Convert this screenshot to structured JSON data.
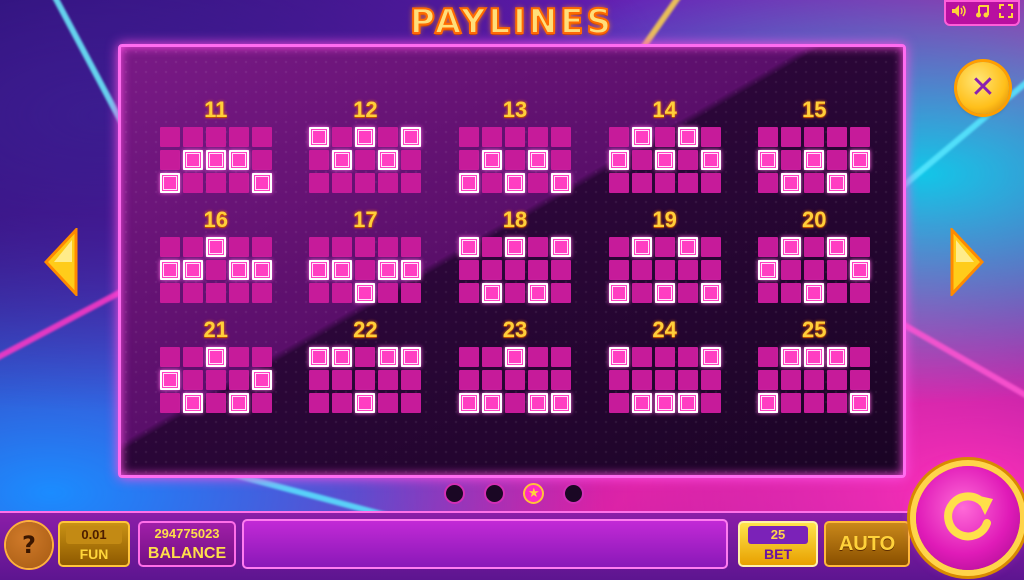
{
  "header": {
    "title": "PAYLINES"
  },
  "top_controls": {
    "sound_icon": "speaker-icon",
    "music_icon": "music-note-icon",
    "fullscreen_icon": "fullscreen-icon"
  },
  "paylines": [
    {
      "number": "11",
      "rows": [
        [
          0,
          0,
          0,
          0,
          0
        ],
        [
          0,
          1,
          1,
          1,
          0
        ],
        [
          1,
          0,
          0,
          0,
          1
        ]
      ]
    },
    {
      "number": "12",
      "rows": [
        [
          1,
          0,
          1,
          0,
          1
        ],
        [
          0,
          1,
          0,
          1,
          0
        ],
        [
          0,
          0,
          0,
          0,
          0
        ]
      ]
    },
    {
      "number": "13",
      "rows": [
        [
          0,
          0,
          0,
          0,
          0
        ],
        [
          0,
          1,
          0,
          1,
          0
        ],
        [
          1,
          0,
          1,
          0,
          1
        ]
      ]
    },
    {
      "number": "14",
      "rows": [
        [
          0,
          1,
          0,
          1,
          0
        ],
        [
          1,
          0,
          1,
          0,
          1
        ],
        [
          0,
          0,
          0,
          0,
          0
        ]
      ]
    },
    {
      "number": "15",
      "rows": [
        [
          0,
          0,
          0,
          0,
          0
        ],
        [
          1,
          0,
          1,
          0,
          1
        ],
        [
          0,
          1,
          0,
          1,
          0
        ]
      ]
    },
    {
      "number": "16",
      "rows": [
        [
          0,
          0,
          1,
          0,
          0
        ],
        [
          1,
          1,
          0,
          1,
          1
        ],
        [
          0,
          0,
          0,
          0,
          0
        ]
      ]
    },
    {
      "number": "17",
      "rows": [
        [
          0,
          0,
          0,
          0,
          0
        ],
        [
          1,
          1,
          0,
          1,
          1
        ],
        [
          0,
          0,
          1,
          0,
          0
        ]
      ]
    },
    {
      "number": "18",
      "rows": [
        [
          1,
          0,
          1,
          0,
          1
        ],
        [
          0,
          0,
          0,
          0,
          0
        ],
        [
          0,
          1,
          0,
          1,
          0
        ]
      ]
    },
    {
      "number": "19",
      "rows": [
        [
          0,
          1,
          0,
          1,
          0
        ],
        [
          0,
          0,
          0,
          0,
          0
        ],
        [
          1,
          0,
          1,
          0,
          1
        ]
      ]
    },
    {
      "number": "20",
      "rows": [
        [
          0,
          1,
          0,
          1,
          0
        ],
        [
          1,
          0,
          0,
          0,
          1
        ],
        [
          0,
          0,
          1,
          0,
          0
        ]
      ]
    },
    {
      "number": "21",
      "rows": [
        [
          0,
          0,
          1,
          0,
          0
        ],
        [
          1,
          0,
          0,
          0,
          1
        ],
        [
          0,
          1,
          0,
          1,
          0
        ]
      ]
    },
    {
      "number": "22",
      "rows": [
        [
          1,
          1,
          0,
          1,
          1
        ],
        [
          0,
          0,
          0,
          0,
          0
        ],
        [
          0,
          0,
          1,
          0,
          0
        ]
      ]
    },
    {
      "number": "23",
      "rows": [
        [
          0,
          0,
          1,
          0,
          0
        ],
        [
          0,
          0,
          0,
          0,
          0
        ],
        [
          1,
          1,
          0,
          1,
          1
        ]
      ]
    },
    {
      "number": "24",
      "rows": [
        [
          1,
          0,
          0,
          0,
          1
        ],
        [
          0,
          0,
          0,
          0,
          0
        ],
        [
          0,
          1,
          1,
          1,
          0
        ]
      ]
    },
    {
      "number": "25",
      "rows": [
        [
          0,
          1,
          1,
          1,
          0
        ],
        [
          0,
          0,
          0,
          0,
          0
        ],
        [
          1,
          0,
          0,
          0,
          1
        ]
      ]
    }
  ],
  "navigation": {
    "prev_icon": "arrow-left-icon",
    "next_icon": "arrow-right-icon",
    "close_label": "✕"
  },
  "pager": {
    "pages": 4,
    "active_index": 2,
    "active_symbol": "★"
  },
  "bottom_bar": {
    "help_label": "?",
    "fun_value": "0.01",
    "fun_label": "FUN",
    "balance_value": "294775023",
    "balance_label": "BALANCE",
    "message": "",
    "bet_value": "25",
    "bet_label": "BET",
    "auto_label": "AUTO",
    "spin_icon": "spin-arrow-icon"
  },
  "colors": {
    "accent_gold": "#ffcf3a",
    "cell_off": "#c61b9a",
    "cell_on": "#ff3fc2",
    "panel_border": "#ff6cf0"
  }
}
